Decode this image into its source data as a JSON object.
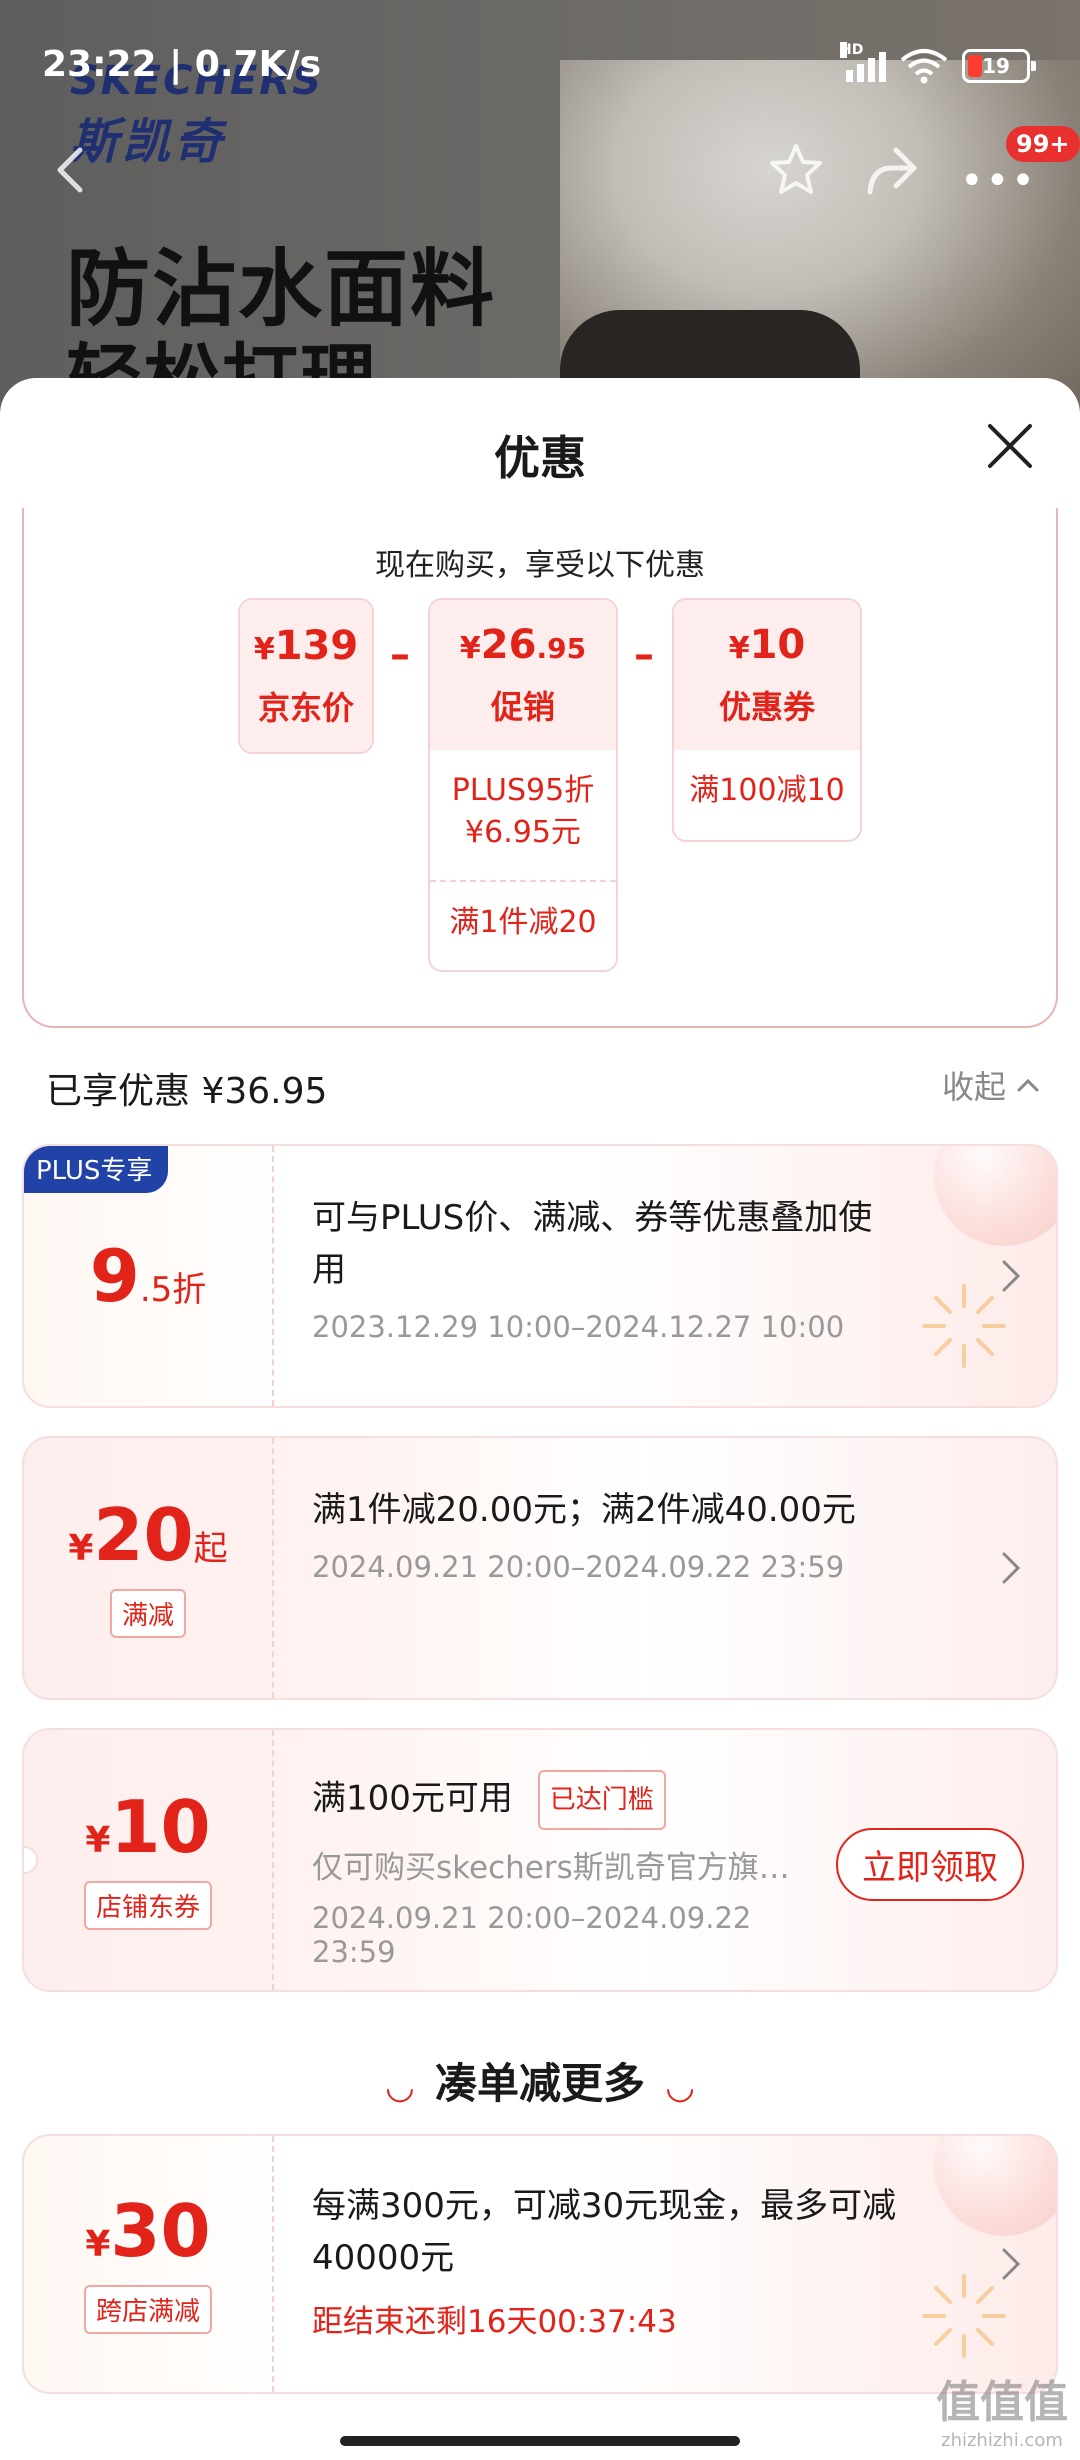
{
  "status_bar": {
    "time": "23:22 | 0.7K/s",
    "network": "HD",
    "battery": "19"
  },
  "background": {
    "brand_en": "SKECHERS",
    "brand_cn": "斯凯奇",
    "hero_line1": "防沾水面料",
    "hero_line2": "轻松打理",
    "notification_badge": "99+"
  },
  "sheet": {
    "title": "优惠",
    "summary_title": "现在购买，享受以下优惠",
    "price_cards": [
      {
        "amount": "139",
        "label": "京东价"
      },
      {
        "amount": "26",
        "decimals": ".95",
        "label": "促销",
        "rows": [
          "PLUS95折\n¥6.95元",
          "满1件减20"
        ]
      },
      {
        "amount": "10",
        "label": "优惠券",
        "rows": [
          "满100减10"
        ]
      }
    ],
    "enjoyed_label": "已享优惠 ¥36.95",
    "collapse_label": "收起",
    "coupons": [
      {
        "badge": "PLUS专享",
        "value": "9",
        "value_suffix": ".5折",
        "description": "可与PLUS价、满减、券等优惠叠加使用",
        "date": "2023.12.29 10:00–2024.12.27 10:00"
      },
      {
        "value": "20",
        "value_suffix": "起",
        "tag": "满减",
        "description": "满1件减20.00元；满2件减40.00元",
        "date": "2024.09.21 20:00–2024.09.22 23:59"
      },
      {
        "value": "10",
        "tag": "店铺东券",
        "description": "满100元可用",
        "threshold": "已达门槛",
        "subtitle": "仅可购买skechers斯凯奇官方旗…",
        "date": "2024.09.21 20:00–2024.09.22 23:59",
        "button": "立即领取"
      }
    ],
    "more_title": "凑单减更多",
    "cross_store": {
      "value": "30",
      "tag": "跨店满减",
      "description": "每满300元，可减30元现金，最多可减40000元",
      "countdown": "距结束还剩16天00:37:43"
    }
  },
  "watermark": {
    "main": "值值值",
    "sub": "zhizhizhi.com"
  },
  "colors": {
    "accent": "#e2231a",
    "plus_badge": "#2143a8"
  },
  "icons": [
    "back-icon",
    "star-icon",
    "share-icon",
    "more-icon",
    "close-icon",
    "chevron-up-icon",
    "chevron-right-icon",
    "wifi-icon",
    "battery-icon",
    "signal-icon"
  ]
}
